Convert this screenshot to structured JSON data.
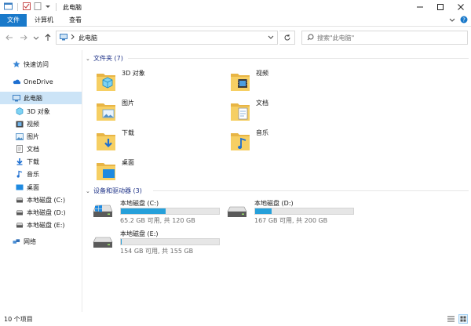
{
  "window": {
    "title": "此电脑"
  },
  "ribbon": {
    "tabs": [
      "文件",
      "计算机",
      "查看"
    ]
  },
  "address": {
    "path": "此电脑"
  },
  "search": {
    "placeholder": "搜索\"此电脑\""
  },
  "sidebar": {
    "items": [
      {
        "label": "快速访问",
        "icon": "star-icon"
      },
      {
        "label": "OneDrive",
        "icon": "cloud-icon"
      },
      {
        "label": "此电脑",
        "icon": "computer-icon",
        "selected": true
      },
      {
        "label": "3D 对象",
        "icon": "cube-icon"
      },
      {
        "label": "视频",
        "icon": "video-icon"
      },
      {
        "label": "图片",
        "icon": "picture-icon"
      },
      {
        "label": "文档",
        "icon": "document-icon"
      },
      {
        "label": "下载",
        "icon": "download-icon"
      },
      {
        "label": "音乐",
        "icon": "music-icon"
      },
      {
        "label": "桌面",
        "icon": "desktop-icon"
      },
      {
        "label": "本地磁盘 (C:)",
        "icon": "windows-drive-icon"
      },
      {
        "label": "本地磁盘 (D:)",
        "icon": "drive-icon"
      },
      {
        "label": "本地磁盘 (E:)",
        "icon": "drive-icon"
      },
      {
        "label": "网络",
        "icon": "network-icon"
      }
    ]
  },
  "folders_group": {
    "title": "文件夹 (7)",
    "items": [
      {
        "label": "3D 对象",
        "icon": "cube-folder-icon"
      },
      {
        "label": "视频",
        "icon": "video-folder-icon"
      },
      {
        "label": "图片",
        "icon": "picture-folder-icon"
      },
      {
        "label": "文档",
        "icon": "document-folder-icon"
      },
      {
        "label": "下载",
        "icon": "download-folder-icon"
      },
      {
        "label": "音乐",
        "icon": "music-folder-icon"
      },
      {
        "label": "桌面",
        "icon": "desktop-folder-icon"
      }
    ]
  },
  "drives_group": {
    "title": "设备和驱动器 (3)",
    "items": [
      {
        "label": "本地磁盘 (C:)",
        "detail": "65.2 GB 可用, 共 120 GB",
        "used_fraction": 0.457,
        "icon": "windows-drive-icon"
      },
      {
        "label": "本地磁盘 (D:)",
        "detail": "167 GB 可用, 共 200 GB",
        "used_fraction": 0.165,
        "icon": "drive-icon"
      },
      {
        "label": "本地磁盘 (E:)",
        "detail": "154 GB 可用, 共 155 GB",
        "used_fraction": 0.006,
        "icon": "drive-icon"
      }
    ]
  },
  "status": {
    "count": "10 个项目"
  },
  "colors": {
    "accent": "#1979ca",
    "selection": "#cce4f7",
    "bar_fill": "#26a0da",
    "folder": "#f2c44f",
    "group_header": "#1e3287"
  }
}
